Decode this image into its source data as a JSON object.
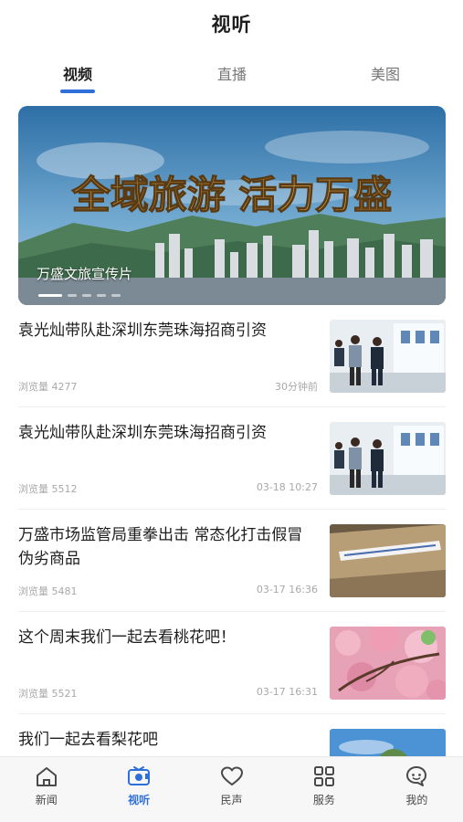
{
  "header": {
    "title": "视听"
  },
  "tabs": [
    {
      "label": "视频",
      "active": true
    },
    {
      "label": "直播",
      "active": false
    },
    {
      "label": "美图",
      "active": false
    }
  ],
  "banner": {
    "slogan": "全域旅游 活力万盛",
    "caption": "万盛文旅宣传片",
    "dot_count": 5,
    "active_dot": 1
  },
  "news": [
    {
      "title": "袁光灿带队赴深圳东莞珠海招商引资",
      "views": "浏览量 4277",
      "time": "30分钟前",
      "thumb": "office-visit"
    },
    {
      "title": "袁光灿带队赴深圳东莞珠海招商引资",
      "views": "浏览量 5512",
      "time": "03-18 10:27",
      "thumb": "office-visit"
    },
    {
      "title": "万盛市场监管局重拳出击 常态化打击假冒伪劣商品",
      "views": "浏览量 5481",
      "time": "03-17 16:36",
      "thumb": "sealed-boxes"
    },
    {
      "title": "这个周末我们一起去看桃花吧！",
      "views": "浏览量 5521",
      "time": "03-17 16:31",
      "thumb": "peach-blossoms"
    },
    {
      "title": "我们一起去看梨花吧",
      "views": "",
      "time": "",
      "thumb": "sky-trees"
    }
  ],
  "bottom_nav": [
    {
      "label": "新闻",
      "icon": "home-icon",
      "active": false
    },
    {
      "label": "视听",
      "icon": "video-icon",
      "active": true
    },
    {
      "label": "民声",
      "icon": "heart-icon",
      "active": false
    },
    {
      "label": "服务",
      "icon": "grid-icon",
      "active": false
    },
    {
      "label": "我的",
      "icon": "user-icon",
      "active": false
    }
  ],
  "colors": {
    "accent": "#2f6fd9",
    "text": "#1e1e1e",
    "meta": "#a8a8a8"
  }
}
